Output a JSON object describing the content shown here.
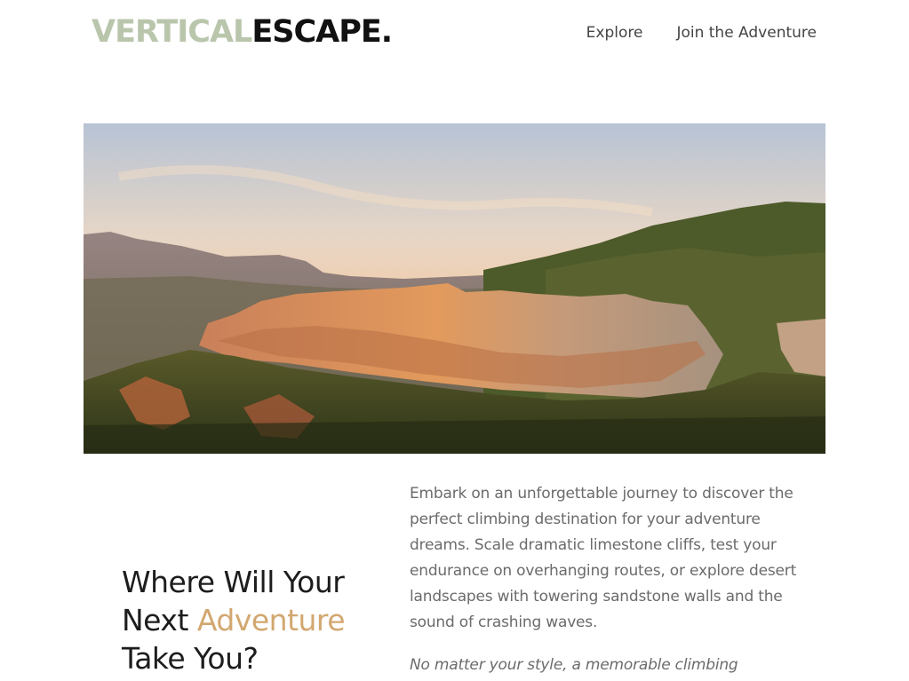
{
  "brand": {
    "part1": "VERTICAL",
    "part2": "ESCAPE.",
    "part1_color": "#b9c6ac",
    "part2_color": "#111111"
  },
  "nav": {
    "explore": "Explore",
    "join": "Join the Adventure"
  },
  "hero": {
    "image_icon": "landscape-photo",
    "colors": {
      "sky_top": "#bcc6d6",
      "sky_horizon": "#f6caa0",
      "cliff": "#d08a55",
      "forest": "#3f4a22"
    }
  },
  "intro": {
    "heading_part1": "Where Will Your",
    "heading_part2": "Next ",
    "heading_accent": "Adventure",
    "heading_part3": "Take You?",
    "accent_color": "#d2a76f",
    "paragraph1": "Embark on an unforgettable journey to discover the perfect climbing destination for your adventure dreams. Scale dramatic limestone cliffs, test your endurance on overhanging routes, or explore desert landscapes with towering sandstone walls and the sound of crashing waves.",
    "paragraph2": "No matter your style, a memorable climbing"
  }
}
